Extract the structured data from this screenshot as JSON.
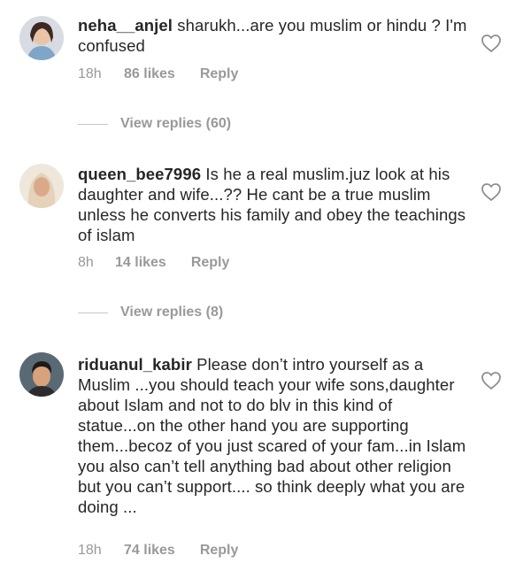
{
  "comments": [
    {
      "username": "neha__anjel",
      "text": "sharukh...are you muslim or hindu ? I'm confused",
      "time": "18h",
      "likes": "86 likes",
      "reply": "Reply",
      "view_replies": "View replies (60)"
    },
    {
      "username": "queen_bee7996",
      "text": "Is he a real muslim.juz look at his daughter and wife...?? He cant be a true muslim unless he converts his family and obey the teachings of islam",
      "time": "8h",
      "likes": "14 likes",
      "reply": "Reply",
      "view_replies": "View replies (8)"
    },
    {
      "username": "riduanul_kabir",
      "text": "Please don’t intro yourself as a Muslim ...you should teach your wife sons,daughter about Islam and not to do blv in this kind of statue...on the other hand you are supporting them...becoz of you just scared of your fam...in Islam you also can’t tell anything bad about other religion but you can’t support.... so think deeply what you are doing ...",
      "time": "18h",
      "likes": "74 likes",
      "reply": "Reply"
    }
  ],
  "icons": {
    "like": "heart-outline-icon"
  },
  "colors": {
    "text": "#262626",
    "secondary": "#999999",
    "divider": "#c7c7c7"
  }
}
